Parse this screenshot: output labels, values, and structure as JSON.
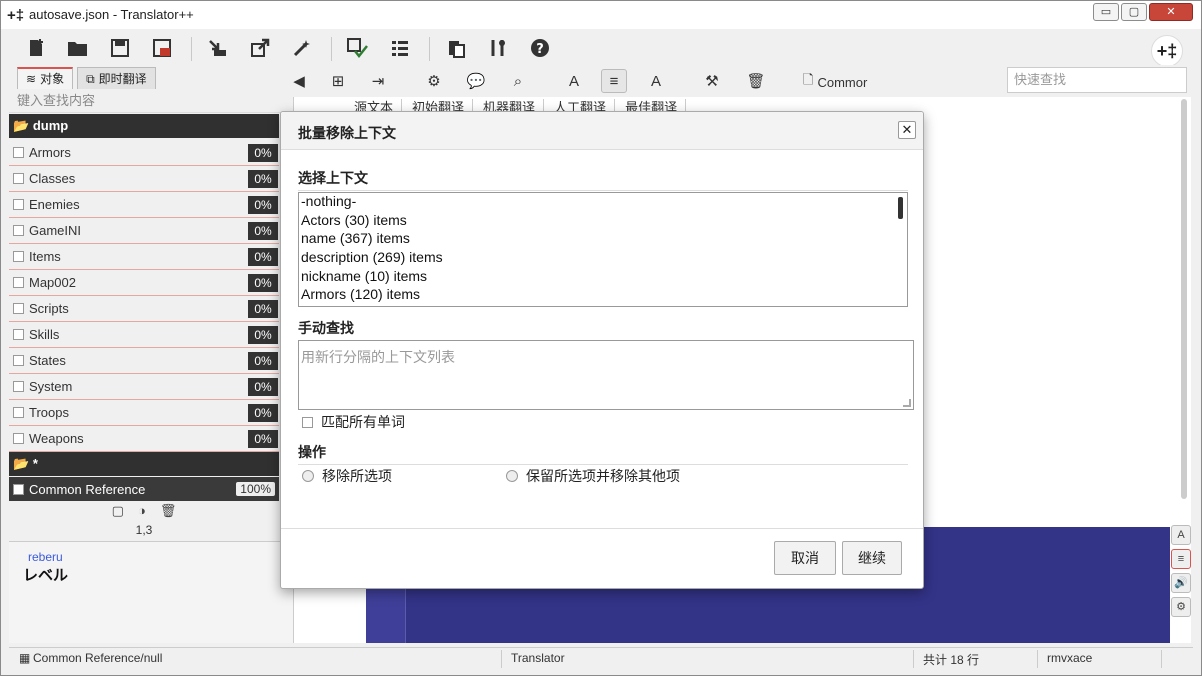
{
  "window": {
    "title": "autosave.json - Translator++",
    "app_icon": "+‡",
    "controls": {
      "minimize": "▭",
      "maximize": "▢",
      "close": "✕"
    }
  },
  "main_toolbar": {
    "icons": [
      "new-file-icon",
      "open-folder-icon",
      "save-icon",
      "save-as-icon",
      "import-icon",
      "export-icon",
      "magic-wand-icon",
      "translate-check-icon",
      "list-icon",
      "clipboard-icon",
      "tools-icon",
      "help-icon"
    ],
    "logo": "+‡"
  },
  "left_panel": {
    "tabs": [
      {
        "label": "对象",
        "active": true
      },
      {
        "label": "即时翻译",
        "active": false
      }
    ],
    "search_placeholder": "键入查找内容",
    "folder_dump": "dump",
    "files": [
      {
        "name": "Armors",
        "progress": "0%"
      },
      {
        "name": "Classes",
        "progress": "0%"
      },
      {
        "name": "Enemies",
        "progress": "0%"
      },
      {
        "name": "GameINI",
        "progress": "0%"
      },
      {
        "name": "Items",
        "progress": "0%"
      },
      {
        "name": "Map002",
        "progress": "0%"
      },
      {
        "name": "Scripts",
        "progress": "0%"
      },
      {
        "name": "Skills",
        "progress": "0%"
      },
      {
        "name": "States",
        "progress": "0%"
      },
      {
        "name": "System",
        "progress": "0%"
      },
      {
        "name": "Troops",
        "progress": "0%"
      },
      {
        "name": "Weapons",
        "progress": "0%"
      }
    ],
    "folder_star": "*",
    "common_reference": {
      "name": "Common Reference",
      "progress": "100%"
    },
    "mini_tools": [
      "▢",
      "◑",
      "🗑"
    ],
    "coord": "1,3",
    "preview_small": "reberu",
    "preview_big": "レベル"
  },
  "editor_toolbar": {
    "common_label": "Commor",
    "quick_search_placeholder": "快速查找",
    "columns": [
      "源文本",
      "初始翻译",
      "机器翻译",
      "人工翻译",
      "最佳翻译"
    ]
  },
  "side_tools": [
    "A",
    "≡",
    "🔊",
    "⚙"
  ],
  "statusbar": {
    "path": "Common Reference/null",
    "app": "Translator",
    "rows": "共计 18 行",
    "engine": "rmvxace"
  },
  "modal": {
    "title": "批量移除上下文",
    "close": "✕",
    "select_context_title": "选择上下文",
    "context_items": [
      "-nothing-",
      "Actors (30) items",
      "name (367) items",
      "description (269) items",
      "nickname (10) items",
      "Armors (120) items"
    ],
    "manual_search_title": "手动查找",
    "manual_placeholder": "用新行分隔的上下文列表",
    "match_all_words": "匹配所有单词",
    "operation_title": "操作",
    "option_remove_selected": "移除所选项",
    "option_keep_selected": "保留所选项并移除其他项",
    "cancel_label": "取消",
    "continue_label": "继续"
  }
}
